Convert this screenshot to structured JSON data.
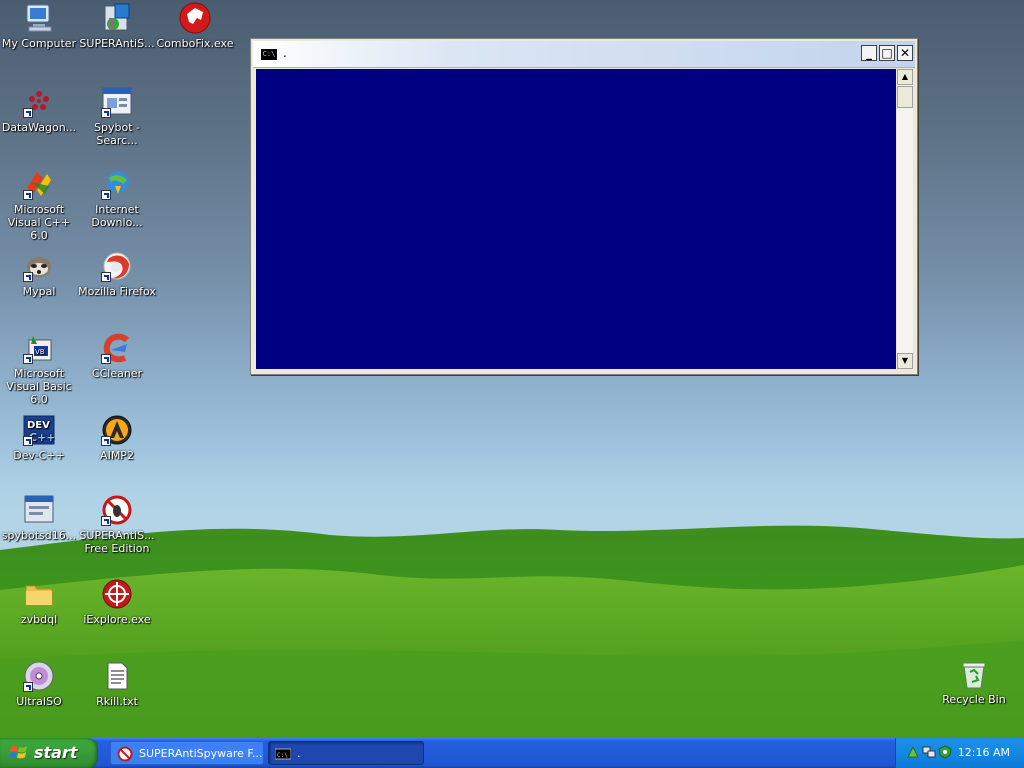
{
  "desktop": {
    "icons": [
      {
        "label": "My Computer",
        "icon": "my-computer-icon"
      },
      {
        "label": "SUPERAntiS...",
        "icon": "superantispyware-installer-icon"
      },
      {
        "label": "ComboFix.exe",
        "icon": "combofix-icon"
      },
      {
        "label": "DataWagon...",
        "icon": "datawagon-icon"
      },
      {
        "label": "Spybot - Searc...",
        "icon": "spybot-icon"
      },
      {
        "label": "Microsoft Visual C++ 6.0",
        "icon": "visual-cpp-icon"
      },
      {
        "label": "Internet Downlo...",
        "icon": "internet-download-manager-icon"
      },
      {
        "label": "Mypal",
        "icon": "mypal-icon"
      },
      {
        "label": "Mozilla Firefox",
        "icon": "firefox-icon"
      },
      {
        "label": "Microsoft Visual Basic 6.0",
        "icon": "visual-basic-icon"
      },
      {
        "label": "CCleaner",
        "icon": "ccleaner-icon"
      },
      {
        "label": "Dev-C++",
        "icon": "dev-cpp-icon"
      },
      {
        "label": "AIMP2",
        "icon": "aimp2-icon"
      },
      {
        "label": "spybotsd16...",
        "icon": "spybot-installer-icon"
      },
      {
        "label": "SUPERAntiS... Free Edition",
        "icon": "superantispyware-icon"
      },
      {
        "label": "zvbdql",
        "icon": "folder-icon"
      },
      {
        "label": "iExplore.exe",
        "icon": "iexplore-icon"
      },
      {
        "label": "UltraISO",
        "icon": "ultraiso-icon"
      },
      {
        "label": "Rkill.txt",
        "icon": "text-file-icon"
      },
      {
        "label": "Recycle Bin",
        "icon": "recycle-bin-icon"
      }
    ]
  },
  "console_window": {
    "title": ".",
    "icon_text": "C:\\",
    "minimize_glyph": "_",
    "maximize_glyph": "□",
    "close_glyph": "✕",
    "scroll_up_glyph": "▲",
    "scroll_down_glyph": "▼",
    "background_color": "#000080"
  },
  "taskbar": {
    "start_label": "start",
    "buttons": [
      {
        "label": "SUPERAntiSpyware F...",
        "icon": "superantispyware-icon"
      },
      {
        "label": ".",
        "icon": "console-icon",
        "active": true
      }
    ],
    "tray": {
      "clock": "12:16 AM"
    }
  }
}
